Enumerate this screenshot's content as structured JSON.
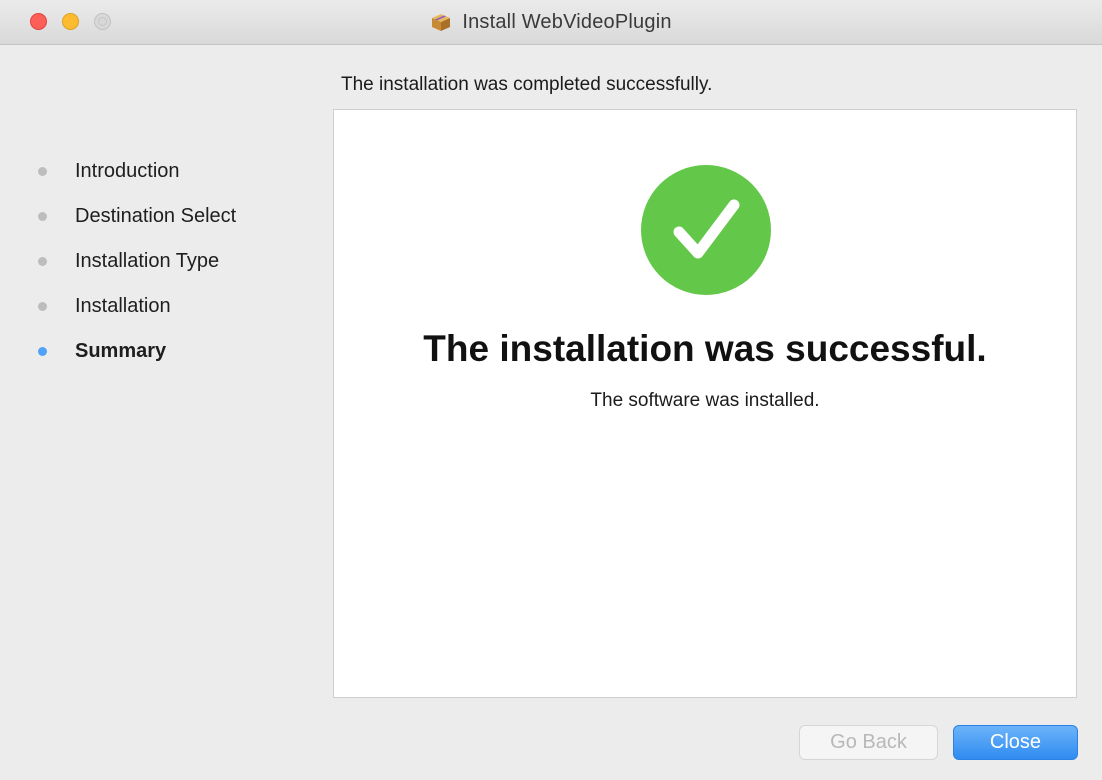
{
  "window": {
    "title": "Install WebVideoPlugin",
    "title_icon": "package-icon"
  },
  "status_text": "The installation was completed successfully.",
  "steps": [
    {
      "label": "Introduction",
      "active": false
    },
    {
      "label": "Destination Select",
      "active": false
    },
    {
      "label": "Installation Type",
      "active": false
    },
    {
      "label": "Installation",
      "active": false
    },
    {
      "label": "Summary",
      "active": true
    }
  ],
  "main": {
    "icon": "checkmark-success-icon",
    "headline": "The installation was successful.",
    "message": "The software was installed."
  },
  "buttons": {
    "back_label": "Go Back",
    "back_enabled": false,
    "close_label": "Close"
  },
  "colors": {
    "success_green": "#63c84a",
    "active_step_blue": "#4fa3f7",
    "primary_button_blue": "#2f8cf0"
  }
}
